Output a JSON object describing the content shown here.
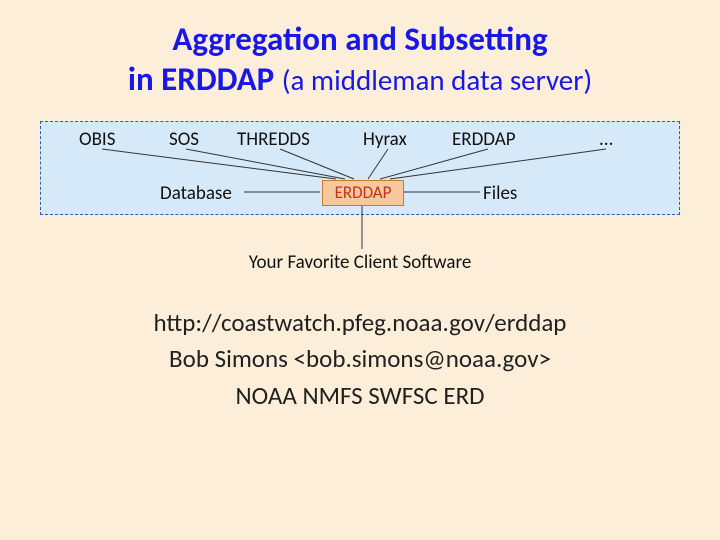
{
  "title": {
    "line1": "Aggregation and Subsetting",
    "line2_bold": "in ERDDAP ",
    "line2_rest": "(a middleman data server)"
  },
  "diagram": {
    "sources": [
      "OBIS",
      "SOS",
      "THREDDS",
      "Hyrax",
      "ERDDAP",
      "..."
    ],
    "left_input": "Database",
    "right_input": "Files",
    "center_node": "ERDDAP",
    "client": "Your Favorite Client Software"
  },
  "footer": {
    "url": "http://coastwatch.pfeg.noaa.gov/erddap",
    "author": "Bob Simons <bob.simons@noaa.gov>",
    "org": "NOAA NMFS SWFSC ERD"
  }
}
